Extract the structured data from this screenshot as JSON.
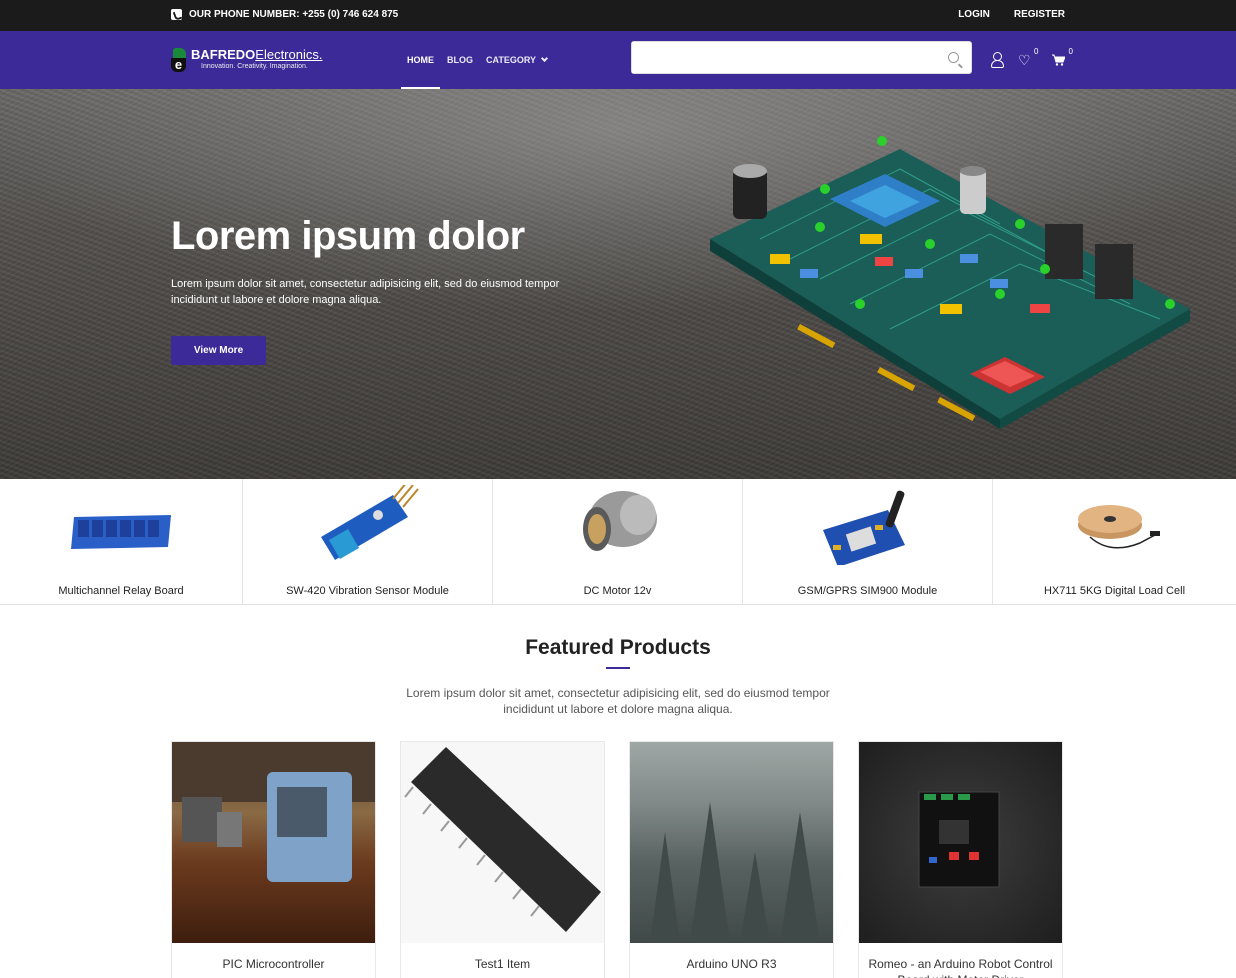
{
  "topbar": {
    "phone_text": "OUR PHONE NUMBER: +255 (0) 746 624 875",
    "login": "LOGIN",
    "register": "REGISTER"
  },
  "header": {
    "logo_brand": "BAFREDO",
    "logo_suffix": "Electronics.",
    "logo_tagline": "Innovation. Creativity. Imagination.",
    "nav": [
      {
        "label": "HOME",
        "active": true
      },
      {
        "label": "BLOG",
        "active": false
      },
      {
        "label": "CATEGORY",
        "active": false
      }
    ],
    "search_placeholder": "",
    "wishlist_count": "0",
    "cart_count": "0"
  },
  "hero": {
    "title": "Lorem ipsum dolor",
    "description": "Lorem ipsum dolor sit amet, consectetur adipisicing elit, sed do eiusmod tempor incididunt ut labore et dolore magna aliqua.",
    "button": "View More"
  },
  "categories": [
    {
      "label": "Multichannel Relay Board"
    },
    {
      "label": "SW-420 Vibration Sensor Module"
    },
    {
      "label": "DC Motor 12v"
    },
    {
      "label": "GSM/GPRS SIM900 Module"
    },
    {
      "label": "HX711 5KG Digital Load Cell"
    }
  ],
  "featured": {
    "title": "Featured Products",
    "description": "Lorem ipsum dolor sit amet, consectetur adipisicing elit, sed do eiusmod tempor incididunt ut labore et dolore magna aliqua.",
    "products": [
      {
        "name": "PIC Microcontroller"
      },
      {
        "name": "Test1 Item"
      },
      {
        "name": "Arduino UNO R3"
      },
      {
        "name": "Romeo - an Arduino Robot Control Board with Motor Driver"
      }
    ]
  },
  "colors": {
    "brand": "#3b2a98",
    "topbar": "#1b1b1b"
  }
}
